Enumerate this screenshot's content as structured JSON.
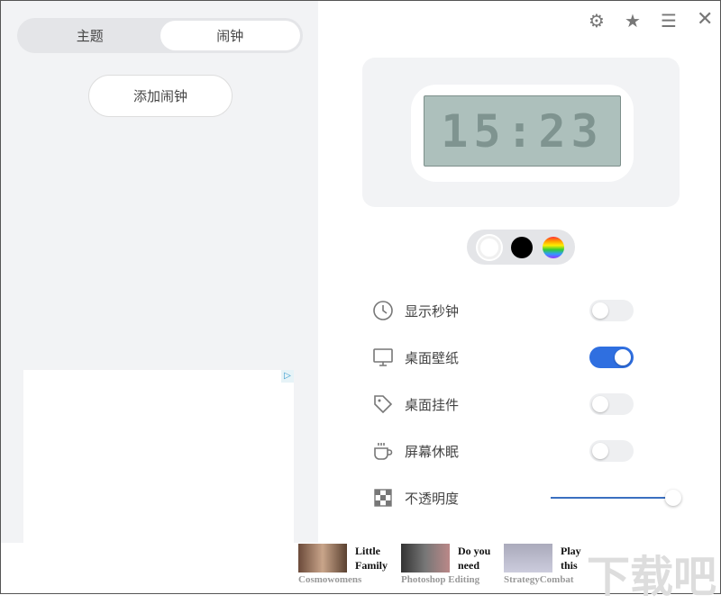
{
  "tabs": [
    {
      "label": "主题",
      "active": false
    },
    {
      "label": "闹钟",
      "active": true
    }
  ],
  "add_alarm_label": "添加闹钟",
  "ad_choice_icon": "ad-choices-icon",
  "toolbar": {
    "icons": [
      "gear-icon",
      "star-icon",
      "menu-icon",
      "close-icon"
    ]
  },
  "clock": {
    "time": "15:23"
  },
  "color_options": [
    {
      "name": "white",
      "color": "#ffffff",
      "selected": true
    },
    {
      "name": "black",
      "color": "#000000",
      "selected": false
    },
    {
      "name": "rainbow",
      "color": "rainbow",
      "selected": false
    }
  ],
  "settings": [
    {
      "label": "显示秒钟",
      "icon": "clock-icon",
      "enabled": false
    },
    {
      "label": "桌面壁纸",
      "icon": "monitor-icon",
      "enabled": true
    },
    {
      "label": "桌面挂件",
      "icon": "tag-icon",
      "enabled": false
    },
    {
      "label": "屏幕休眠",
      "icon": "coffee-cup-icon",
      "enabled": false
    }
  ],
  "opacity": {
    "label": "不透明度",
    "value_percent": 100
  },
  "ads": [
    {
      "title": "Little Family",
      "source": "Cosmowomens"
    },
    {
      "title": "Do you need",
      "source": "Photoshop Editing"
    },
    {
      "title": "Play this",
      "source": "StrategyCombat"
    }
  ],
  "accent_color": "#2f6fe0"
}
